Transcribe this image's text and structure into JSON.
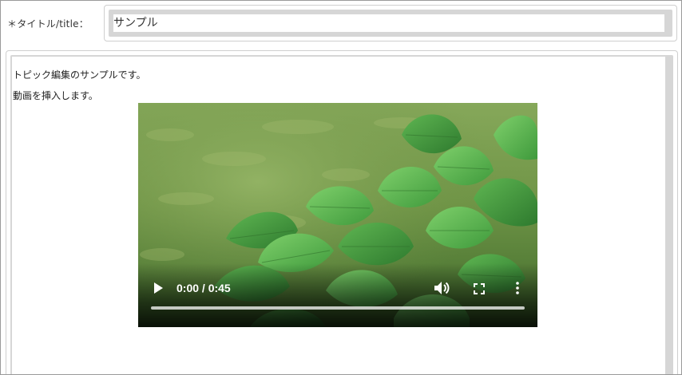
{
  "title_field": {
    "label": "＊タイトル/title：",
    "value": "サンプル"
  },
  "editor": {
    "paragraphs": [
      "トピック編集のサンプルです。",
      "動画を挿入します。"
    ],
    "video": {
      "time_display": "0:00 / 0:45",
      "progress_fraction": 0,
      "controls": {
        "play_icon": "play-icon",
        "volume_icon": "volume-icon",
        "fullscreen_icon": "fullscreen-icon",
        "more_icon": "more-vertical-icon"
      }
    }
  }
}
